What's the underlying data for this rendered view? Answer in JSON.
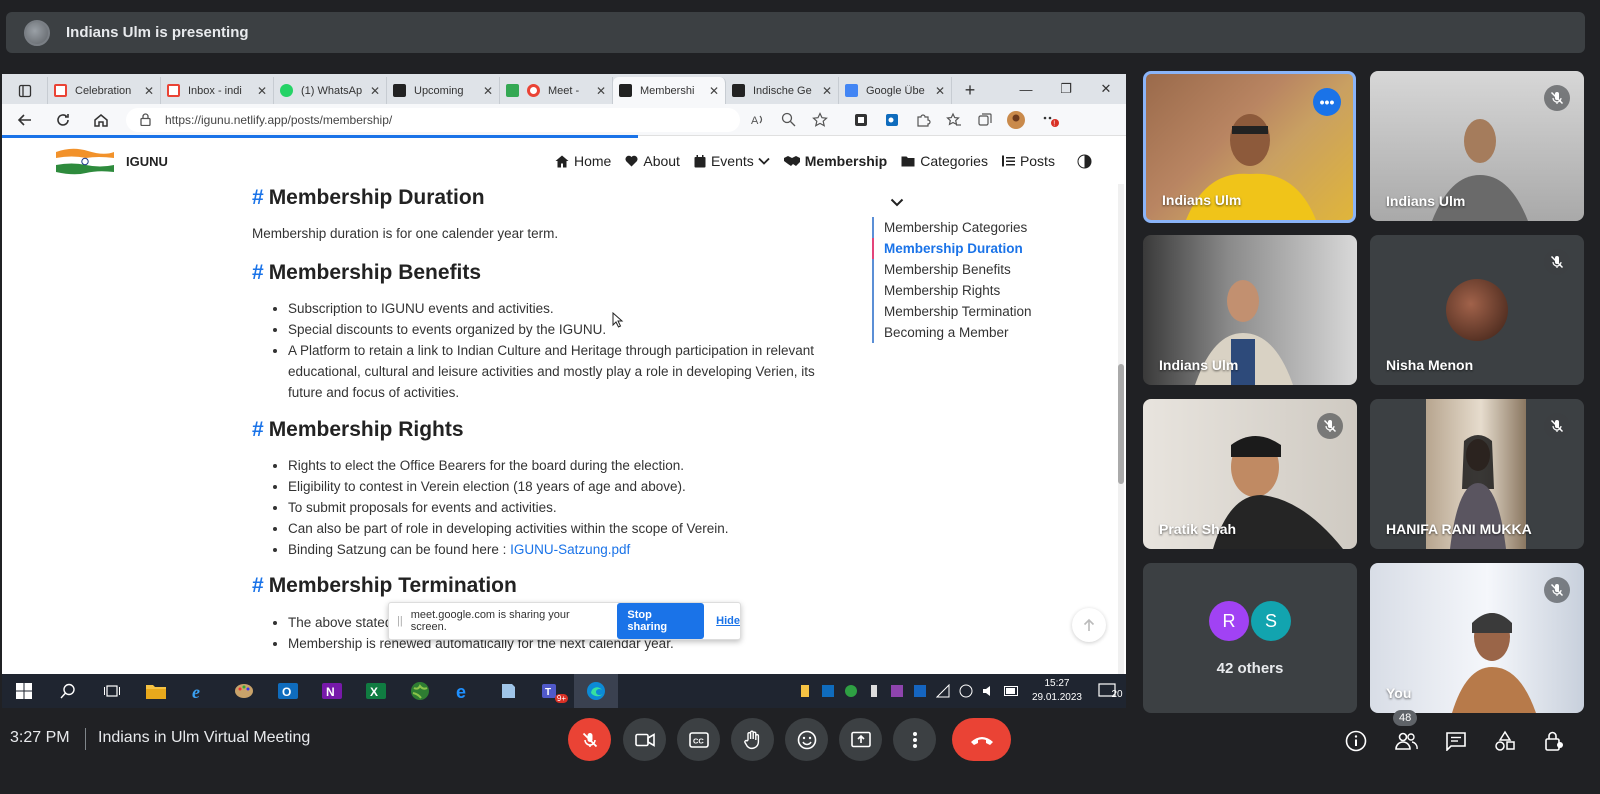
{
  "presenting_bar": {
    "text": "Indians Ulm is presenting"
  },
  "browser": {
    "tabs": [
      {
        "label": "Celebration",
        "favicon_color": "#ea4335"
      },
      {
        "label": "Inbox - indi",
        "favicon_color": "#ea4335"
      },
      {
        "label": "(1) WhatsAp",
        "favicon_color": "#25d366"
      },
      {
        "label": "Upcoming",
        "favicon_color": "#222222"
      },
      {
        "label": "Meet -",
        "favicon_color": "#ea4335"
      },
      {
        "label": "Membershi",
        "favicon_color": "#222222"
      },
      {
        "label": "Indische Ge",
        "favicon_color": "#222222"
      },
      {
        "label": "Google Übe",
        "favicon_color": "#4285f4"
      }
    ],
    "active_tab_index": 5,
    "url": "https://igunu.netlify.app/posts/membership/"
  },
  "site": {
    "name": "IGUNU",
    "menu": [
      {
        "label": "Home",
        "icon": "home-icon"
      },
      {
        "label": "About",
        "icon": "heart-icon"
      },
      {
        "label": "Events",
        "icon": "calendar-icon"
      },
      {
        "label": "Membership",
        "icon": "handshake-icon"
      },
      {
        "label": "Categories",
        "icon": "folder-icon"
      },
      {
        "label": "Posts",
        "icon": "list-icon"
      }
    ]
  },
  "content": {
    "hash": "#",
    "sections": {
      "duration": {
        "heading": "Membership Duration",
        "text": "Membership duration is for one calender year term."
      },
      "benefits": {
        "heading": "Membership Benefits",
        "items": [
          "Subscription to IGUNU events and activities.",
          "Special discounts to events organized by the IGUNU.",
          "A Platform to retain a link to Indian Culture and Heritage through participation in relevant educational, cultural and leisure activities and mostly play a role in developing Verien, its future and focus of activities."
        ]
      },
      "rights": {
        "heading": "Membership Rights",
        "items": [
          "Rights to elect the Office Bearers for the board during the election.",
          "Eligibility to contest in Verein election (18 years of age and above).",
          "To submit proposals for events and activities.",
          "Can also be part of role in developing activities within the scope of Verein."
        ],
        "satzung_prefix": "Binding Satzung can be found here : ",
        "satzung_link": "IGUNU-Satzung.pdf"
      },
      "termination": {
        "heading": "Membership Termination",
        "items": [
          "The above stated fee is for membership for 1 Calendar year.",
          "Membership is renewed automatically for the next calendar year."
        ]
      }
    },
    "toc": [
      "Membership Categories",
      "Membership Duration",
      "Membership Benefits",
      "Membership Rights",
      "Membership Termination",
      "Becoming a Member"
    ],
    "toc_active_index": 1
  },
  "share_notice": {
    "text": "meet.google.com is sharing your screen.",
    "stop_label": "Stop sharing",
    "hide_label": "Hide"
  },
  "taskbar": {
    "time": "15:27",
    "date": "29.01.2023",
    "notifications": "20",
    "teams_badge": "9+"
  },
  "participants": [
    {
      "name": "Indians Ulm",
      "muted": false,
      "speaking": true
    },
    {
      "name": "Indians Ulm",
      "muted": true
    },
    {
      "name": "Indians Ulm",
      "muted": false
    },
    {
      "name": "Nisha Menon",
      "muted": true
    },
    {
      "name": "Pratik Shah",
      "muted": true
    },
    {
      "name": "HANIFA RANI MUKKA",
      "muted": true
    },
    {
      "name": "You",
      "muted": true
    }
  ],
  "others": {
    "avatars": [
      {
        "letter": "R",
        "color": "#a142f4"
      },
      {
        "letter": "S",
        "color": "#12a4af"
      }
    ],
    "label": "42 others"
  },
  "bottom_bar": {
    "time": "3:27 PM",
    "meeting_title": "Indians in Ulm Virtual Meeting",
    "people_count": "48"
  }
}
